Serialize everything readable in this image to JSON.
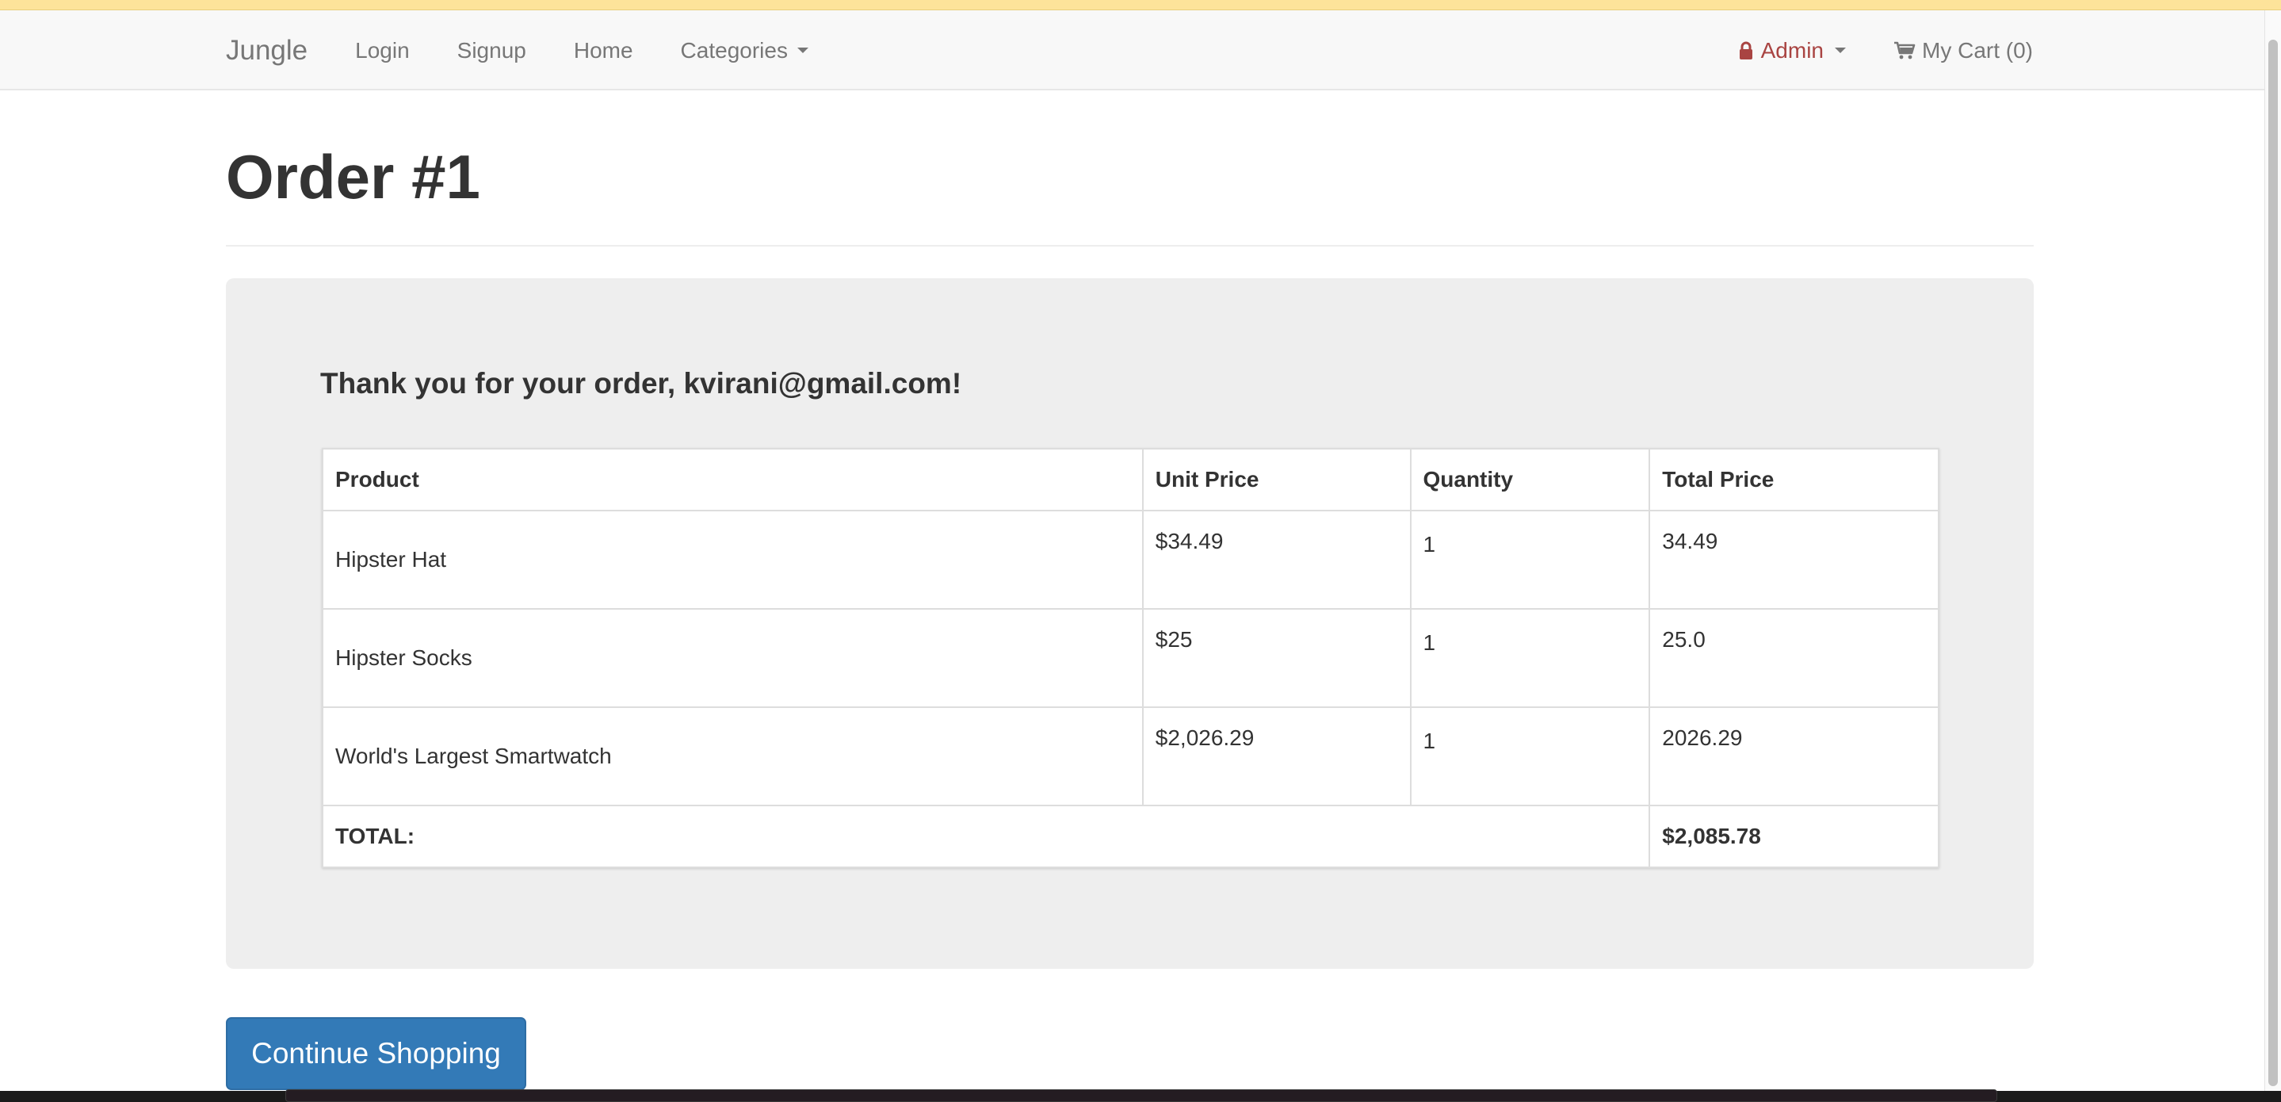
{
  "navbar": {
    "brand": "Jungle",
    "links": [
      "Login",
      "Signup",
      "Home",
      "Categories"
    ],
    "admin_label": "Admin",
    "cart_label": "My Cart (0)"
  },
  "page": {
    "title": "Order #1",
    "thanks_message": "Thank you for your order, kvirani@gmail.com!"
  },
  "table": {
    "headers": [
      "Product",
      "Unit Price",
      "Quantity",
      "Total Price"
    ],
    "rows": [
      {
        "product": "Hipster Hat",
        "unit_price": "$34.49",
        "quantity": "1",
        "total_price": "34.49"
      },
      {
        "product": "Hipster Socks",
        "unit_price": "$25",
        "quantity": "1",
        "total_price": "25.0"
      },
      {
        "product": "World's Largest Smartwatch",
        "unit_price": "$2,026.29",
        "quantity": "1",
        "total_price": "2026.29"
      }
    ],
    "total_label": "TOTAL:",
    "total_value": "$2,085.78"
  },
  "actions": {
    "continue_label": "Continue Shopping"
  },
  "colors": {
    "primary": "#337ab7",
    "admin": "#a94442",
    "panel": "#eeeeee"
  }
}
